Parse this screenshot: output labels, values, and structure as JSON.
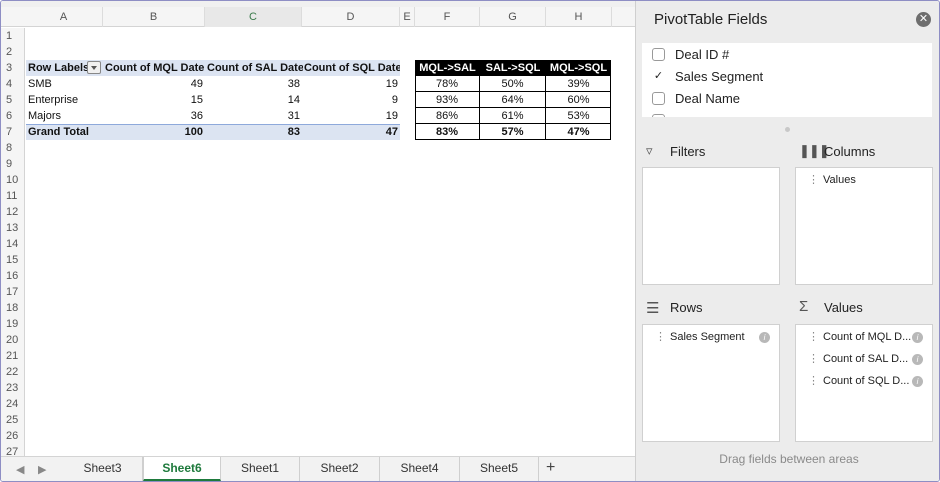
{
  "sheet": {
    "columns": [
      "A",
      "B",
      "C",
      "D",
      "E",
      "F",
      "G",
      "H"
    ],
    "selected_column": "C",
    "rows": [
      "1",
      "2",
      "3",
      "4",
      "5",
      "6",
      "7",
      "8",
      "9",
      "10",
      "11",
      "12",
      "13",
      "14",
      "15",
      "16",
      "17",
      "18",
      "19",
      "20",
      "21",
      "22",
      "23",
      "24",
      "25",
      "26",
      "27"
    ],
    "pivot": {
      "headers": [
        "Row Labels",
        "Count of MQL Date",
        "Count of SAL Date",
        "Count of SQL Date"
      ],
      "data": [
        [
          "SMB",
          "49",
          "38",
          "19"
        ],
        [
          "Enterprise",
          "15",
          "14",
          "9"
        ],
        [
          "Majors",
          "36",
          "31",
          "19"
        ]
      ],
      "total": [
        "Grand Total",
        "100",
        "83",
        "47"
      ]
    },
    "ratios": {
      "headers": [
        "MQL->SAL",
        "SAL->SQL",
        "MQL->SQL"
      ],
      "data": [
        [
          "78%",
          "50%",
          "39%"
        ],
        [
          "93%",
          "64%",
          "60%"
        ],
        [
          "86%",
          "61%",
          "53%"
        ],
        [
          "83%",
          "57%",
          "47%"
        ]
      ]
    }
  },
  "tabs": {
    "items": [
      "Sheet3",
      "Sheet6",
      "Sheet1",
      "Sheet2",
      "Sheet4",
      "Sheet5"
    ],
    "active": "Sheet6",
    "add_label": "+"
  },
  "pivot_panel": {
    "title": "PivotTable Fields",
    "fields": [
      {
        "label": "Deal ID #",
        "checked": false
      },
      {
        "label": "Sales Segment",
        "checked": true
      },
      {
        "label": "Deal Name",
        "checked": false
      }
    ],
    "filters_title": "Filters",
    "columns_title": "Columns",
    "columns_items": [
      "Values"
    ],
    "rows_title": "Rows",
    "rows_items": [
      "Sales Segment"
    ],
    "values_title": "Values",
    "values_items": [
      "Count of MQL D...",
      "Count of SAL D...",
      "Count of SQL D..."
    ],
    "drag_hint": "Drag fields between areas"
  }
}
